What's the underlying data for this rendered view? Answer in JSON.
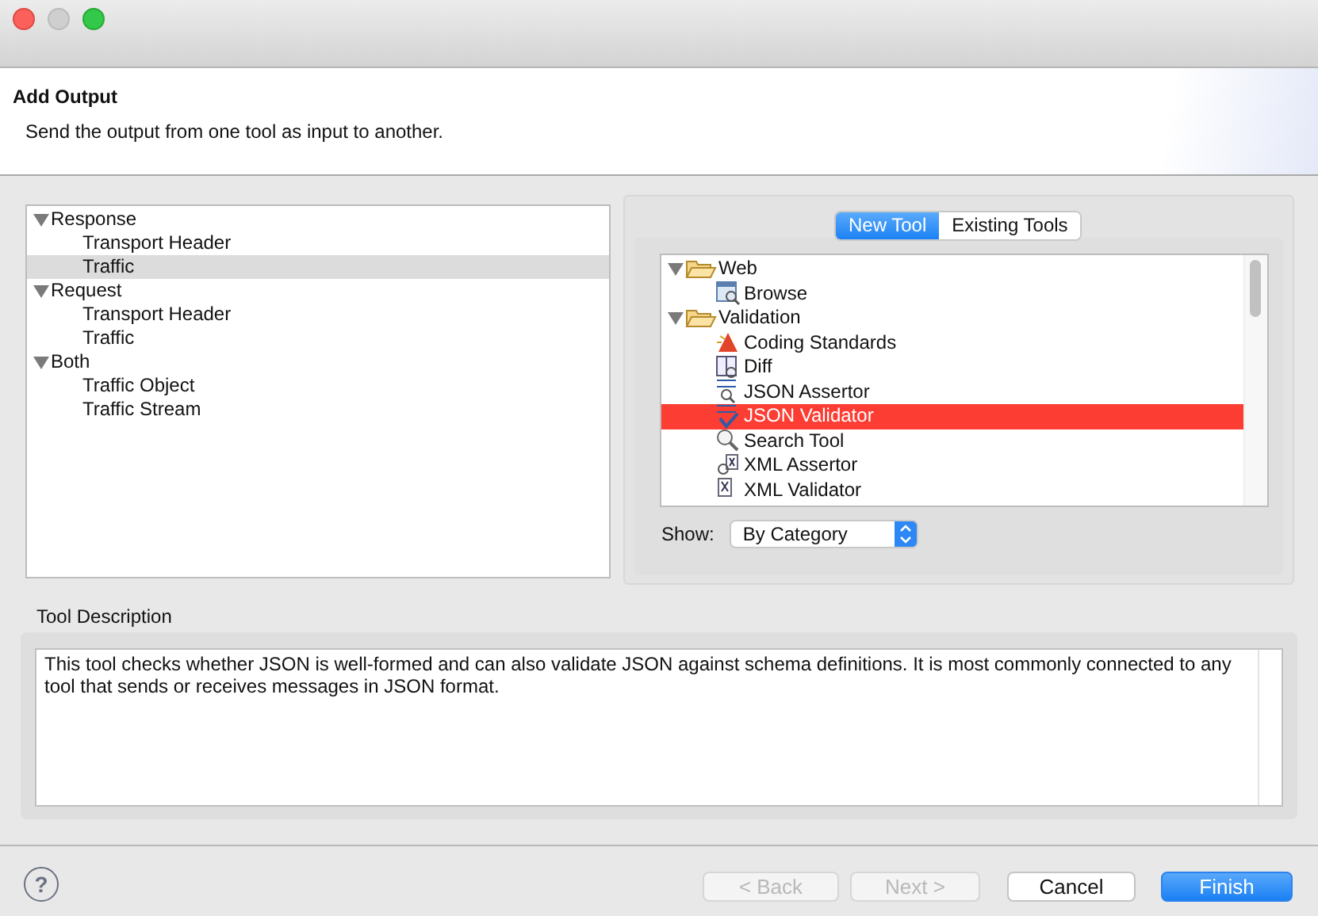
{
  "header": {
    "title": "Add Output",
    "subtitle": "Send the output from one tool as input to another."
  },
  "source_tree": [
    {
      "label": "Response",
      "expanded": true,
      "children": [
        {
          "label": "Transport Header",
          "selected": false
        },
        {
          "label": "Traffic",
          "selected": true
        }
      ]
    },
    {
      "label": "Request",
      "expanded": true,
      "children": [
        {
          "label": "Transport Header",
          "selected": false
        },
        {
          "label": "Traffic",
          "selected": false
        }
      ]
    },
    {
      "label": "Both",
      "expanded": true,
      "children": [
        {
          "label": "Traffic Object",
          "selected": false
        },
        {
          "label": "Traffic Stream",
          "selected": false
        }
      ]
    }
  ],
  "tool_tabs": [
    {
      "label": "New Tool",
      "selected": true
    },
    {
      "label": "Existing Tools",
      "selected": false
    }
  ],
  "tool_tree": [
    {
      "label": "Web",
      "expanded": true,
      "children": [
        {
          "label": "Browse",
          "selected": false
        }
      ]
    },
    {
      "label": "Validation",
      "expanded": true,
      "children": [
        {
          "label": "Coding Standards",
          "selected": false
        },
        {
          "label": "Diff",
          "selected": false
        },
        {
          "label": "JSON Assertor",
          "selected": false
        },
        {
          "label": "JSON Validator",
          "selected": true
        },
        {
          "label": "Search Tool",
          "selected": false
        },
        {
          "label": "XML Assertor",
          "selected": false
        },
        {
          "label": "XML Validator",
          "selected": false
        }
      ]
    }
  ],
  "show": {
    "label": "Show:",
    "value": "By Category"
  },
  "tool_description": {
    "label": "Tool Description",
    "text": "This tool checks whether JSON is well-formed and can also validate JSON against schema definitions. It is most commonly connected to any tool that sends or receives messages in JSON format."
  },
  "help_button": {
    "label": "?"
  },
  "buttons": [
    {
      "label": "< Back",
      "disabled": true,
      "default": false
    },
    {
      "label": "Next >",
      "disabled": true,
      "default": false
    },
    {
      "label": "Cancel",
      "disabled": false,
      "default": false
    },
    {
      "label": "Finish",
      "disabled": false,
      "default": true
    }
  ]
}
